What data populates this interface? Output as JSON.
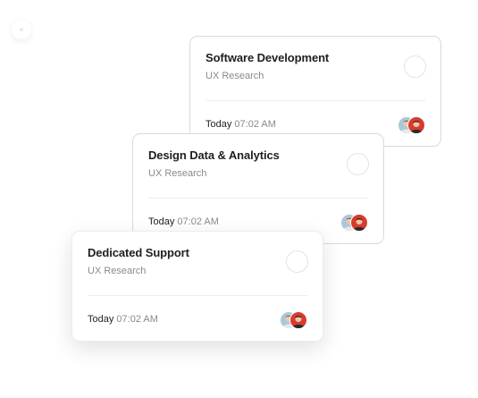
{
  "cards": [
    {
      "title": "Software Development",
      "subtitle": "UX Research",
      "day": "Today",
      "time": "07:02 AM"
    },
    {
      "title": "Design Data & Analytics",
      "subtitle": "UX Research",
      "day": "Today",
      "time": "07:02 AM"
    },
    {
      "title": "Dedicated Support",
      "subtitle": "UX Research",
      "day": "Today",
      "time": "07:02 AM"
    }
  ],
  "colors": {
    "avatar_1_bg": "#a9c8dc",
    "avatar_2_bg": "#d93a2f",
    "title_text": "#1f1f1f",
    "muted_text": "#8a8a8a"
  },
  "icons": {
    "avatar_1": "person-avatar-icon",
    "avatar_2": "person-avatar-icon",
    "select": "empty-circle-icon"
  }
}
